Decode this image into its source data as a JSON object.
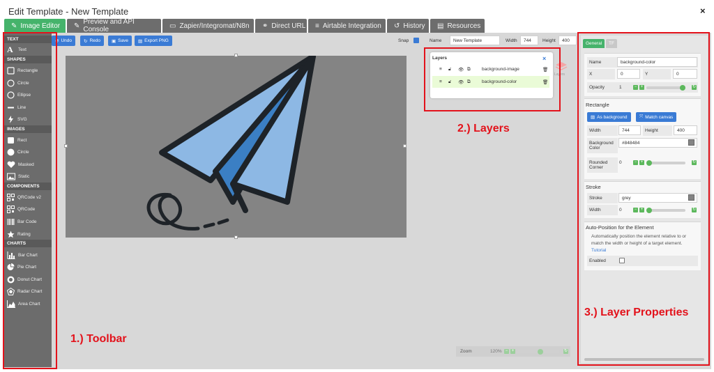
{
  "window": {
    "title": "Edit Template - New Template",
    "close_glyph": "×"
  },
  "tabs": [
    {
      "label": "Image Editor",
      "icon": "pencil-icon",
      "active": true
    },
    {
      "label": "Preview and API Console",
      "icon": "wand-icon"
    },
    {
      "label": "Zapier/Integromat/N8n",
      "icon": "terminal-icon"
    },
    {
      "label": "Direct URL",
      "icon": "link-icon"
    },
    {
      "label": "Airtable Integration",
      "icon": "database-icon"
    },
    {
      "label": "History",
      "icon": "history-icon"
    },
    {
      "label": "Resources",
      "icon": "book-icon"
    }
  ],
  "toolbar": {
    "undo": "Undo",
    "redo": "Redo",
    "save": "Save",
    "export": "Export PNG",
    "snap_label": "Snap",
    "snap_checked": true,
    "name_label": "Name",
    "name_value": "New Template",
    "width_label": "Width",
    "width_value": "744",
    "height_label": "Height",
    "height_value": "400"
  },
  "sidebar": {
    "sections": [
      {
        "title": "TEXT",
        "items": [
          {
            "label": "Text",
            "icon": "text-icon"
          }
        ]
      },
      {
        "title": "SHAPES",
        "items": [
          {
            "label": "Rectangle",
            "icon": "rectangle-icon"
          },
          {
            "label": "Circle",
            "icon": "circle-icon"
          },
          {
            "label": "Ellipse",
            "icon": "ellipse-icon"
          },
          {
            "label": "Line",
            "icon": "line-icon"
          },
          {
            "label": "SVG",
            "icon": "bolt-icon"
          }
        ]
      },
      {
        "title": "IMAGES",
        "items": [
          {
            "label": "Rect",
            "icon": "image-rect-icon"
          },
          {
            "label": "Circle",
            "icon": "image-circle-icon"
          },
          {
            "label": "Masked",
            "icon": "heart-icon"
          },
          {
            "label": "Static",
            "icon": "picture-icon"
          }
        ]
      },
      {
        "title": "COMPONENTS",
        "items": [
          {
            "label": "QRCode v2",
            "icon": "qrcode-icon"
          },
          {
            "label": "QRCode",
            "icon": "qrcode-icon"
          },
          {
            "label": "Bar Code",
            "icon": "barcode-icon"
          },
          {
            "label": "Rating",
            "icon": "star-icon"
          }
        ]
      },
      {
        "title": "CHARTS",
        "items": [
          {
            "label": "Bar Chart",
            "icon": "bar-chart-icon"
          },
          {
            "label": "Pie Chart",
            "icon": "pie-chart-icon"
          },
          {
            "label": "Donut Chart",
            "icon": "donut-chart-icon"
          },
          {
            "label": "Radar Chart",
            "icon": "radar-chart-icon"
          },
          {
            "label": "Area Chart",
            "icon": "area-chart-icon"
          }
        ]
      }
    ]
  },
  "layers": {
    "title": "Layers",
    "close_glyph": "×",
    "side_label": "Layers",
    "rows": [
      {
        "name": "background-image",
        "selected": false
      },
      {
        "name": "background-color",
        "selected": true
      }
    ]
  },
  "zoom": {
    "label": "Zoom",
    "value": "120%",
    "level": 0.55
  },
  "annotations": {
    "toolbar": "1.) Toolbar",
    "layers": "2.) Layers",
    "properties": "3.) Layer Properties"
  },
  "props": {
    "tab_general": "General",
    "tab_tf": "TF",
    "name_label": "Name",
    "name_value": "background-color",
    "x_label": "X",
    "x_value": "0",
    "y_label": "Y",
    "y_value": "0",
    "opacity_label": "Opacity",
    "opacity_value": "1",
    "opacity_level": 1.0,
    "rectangle_title": "Rectangle",
    "as_background": "As background",
    "match_canvas": "Match canvas",
    "width_label": "Width",
    "width_value": "744",
    "height_label": "Height",
    "height_value": "400",
    "bg_color_label_1": "Background",
    "bg_color_label_2": "Color",
    "bg_color_value": "#848484",
    "rounded_label_1": "Rounded",
    "rounded_label_2": "Corner",
    "rounded_value": "0",
    "rounded_level": 0.0,
    "stroke_title": "Stroke",
    "stroke_label": "Stroke",
    "stroke_value": "grey",
    "stroke_width_label": "Width",
    "stroke_width_value": "0",
    "stroke_width_level": 0.0,
    "auto_title": "Auto-Position for the Element",
    "auto_desc_1": "Automatically position the element relative to or",
    "auto_desc_2": "match the width or height of a target element.",
    "tutorial": "Tutorial",
    "enabled_label": "Enabled",
    "enabled": false
  },
  "colors": {
    "accent": "#45b36b",
    "primary": "#3a7bd5",
    "annotation": "#e3121b",
    "canvas_bg": "#848484"
  }
}
